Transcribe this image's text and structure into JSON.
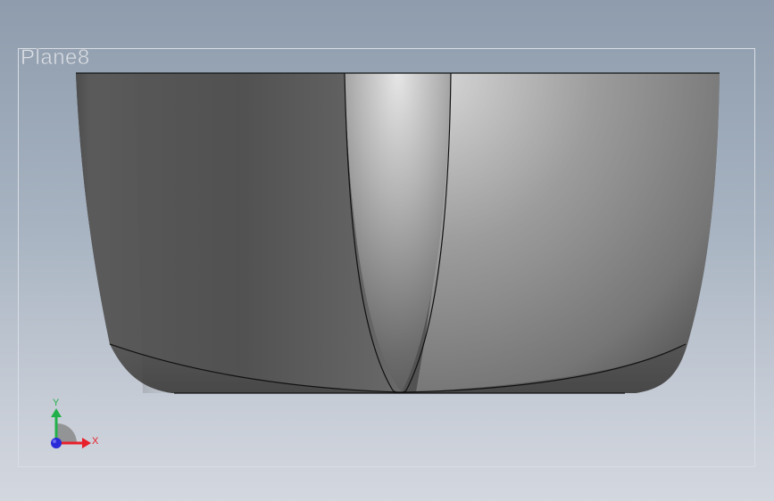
{
  "viewport": {
    "plane_label": "Plane8"
  },
  "triad": {
    "x_label": "X",
    "y_label": "Y",
    "x_color": "#e8202a",
    "y_color": "#22b04a",
    "z_color": "#2a2ad8"
  },
  "model": {
    "description_color_dark": "#4f4f4f",
    "description_color_light": "#e2e2e2"
  }
}
